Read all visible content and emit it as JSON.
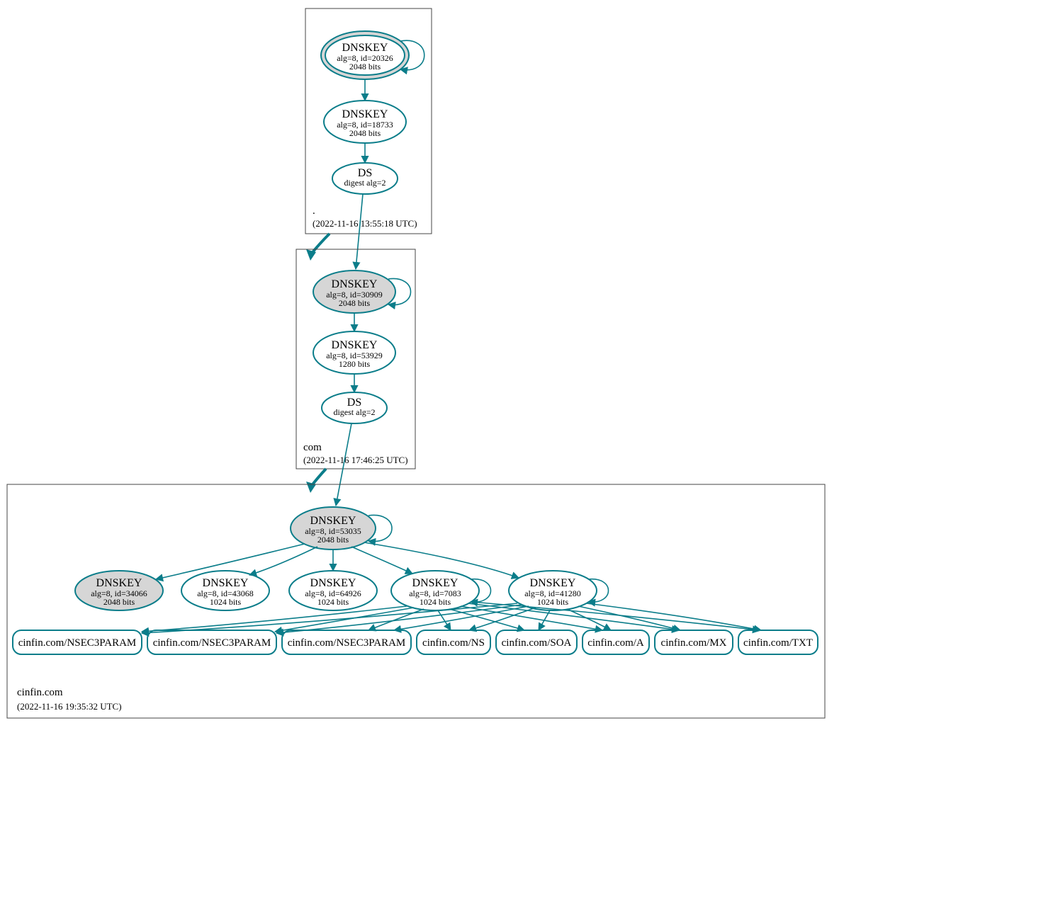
{
  "colors": {
    "stroke": "#0b7d8a",
    "ksk_fill": "#d6d6d6"
  },
  "zones": {
    "root": {
      "label": ".",
      "timestamp": "(2022-11-16 13:55:18 UTC)"
    },
    "com": {
      "label": "com",
      "timestamp": "(2022-11-16 17:46:25 UTC)"
    },
    "leaf": {
      "label": "cinfin.com",
      "timestamp": "(2022-11-16 19:35:32 UTC)"
    }
  },
  "nodes": {
    "root_ksk": {
      "title": "DNSKEY",
      "sub1": "alg=8, id=20326",
      "sub2": "2048 bits"
    },
    "root_zsk": {
      "title": "DNSKEY",
      "sub1": "alg=8, id=18733",
      "sub2": "2048 bits"
    },
    "root_ds": {
      "title": "DS",
      "sub1": "digest alg=2"
    },
    "com_ksk": {
      "title": "DNSKEY",
      "sub1": "alg=8, id=30909",
      "sub2": "2048 bits"
    },
    "com_zsk": {
      "title": "DNSKEY",
      "sub1": "alg=8, id=53929",
      "sub2": "1280 bits"
    },
    "com_ds": {
      "title": "DS",
      "sub1": "digest alg=2"
    },
    "leaf_ksk": {
      "title": "DNSKEY",
      "sub1": "alg=8, id=53035",
      "sub2": "2048 bits"
    },
    "leaf_k1": {
      "title": "DNSKEY",
      "sub1": "alg=8, id=34066",
      "sub2": "2048 bits"
    },
    "leaf_k2": {
      "title": "DNSKEY",
      "sub1": "alg=8, id=43068",
      "sub2": "1024 bits"
    },
    "leaf_k3": {
      "title": "DNSKEY",
      "sub1": "alg=8, id=64926",
      "sub2": "1024 bits"
    },
    "leaf_k4": {
      "title": "DNSKEY",
      "sub1": "alg=8, id=7083",
      "sub2": "1024 bits"
    },
    "leaf_k5": {
      "title": "DNSKEY",
      "sub1": "alg=8, id=41280",
      "sub2": "1024 bits"
    }
  },
  "rr": {
    "r1": "cinfin.com/NSEC3PARAM",
    "r2": "cinfin.com/NSEC3PARAM",
    "r3": "cinfin.com/NSEC3PARAM",
    "r4": "cinfin.com/NS",
    "r5": "cinfin.com/SOA",
    "r6": "cinfin.com/A",
    "r7": "cinfin.com/MX",
    "r8": "cinfin.com/TXT"
  }
}
